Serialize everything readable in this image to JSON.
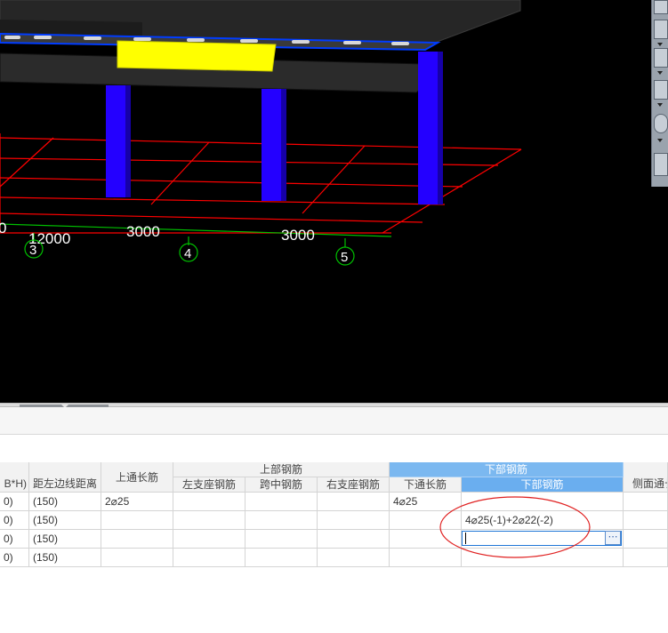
{
  "viewport": {
    "axis_labels": [
      "0",
      "12000",
      "3000",
      "3000"
    ],
    "axis_markers": [
      "3",
      "4",
      "5"
    ],
    "colors": {
      "background": "#000000",
      "grid_line": "#ff0000",
      "axis_line": "#00c000",
      "column": "#2400ff",
      "slab": "#2b2b2b",
      "selected_beam": "#ffff00",
      "beam_edge": "#003cff"
    }
  },
  "right_toolbar": {
    "icons": [
      "view-rotate-icon",
      "view-box-icon",
      "view-box-top-icon",
      "view-cube-icon",
      "orbit-icon",
      "layers-icon"
    ]
  },
  "table": {
    "columns": [
      {
        "key": "bh",
        "label": "B*H)"
      },
      {
        "key": "dist",
        "label": "距左边线距离"
      },
      {
        "key": "top_through",
        "label": "上通长筋"
      },
      {
        "key": "left_support",
        "label": "左支座钢筋"
      },
      {
        "key": "mid_span",
        "label": "跨中钢筋"
      },
      {
        "key": "right_support",
        "label": "右支座钢筋"
      },
      {
        "key": "bottom_through",
        "label": "下通长筋"
      },
      {
        "key": "bottom_bars",
        "label": "下部钢筋"
      },
      {
        "key": "side_through",
        "label": "侧面通长"
      }
    ],
    "group_headers": {
      "top_bars": "上部钢筋",
      "bottom_bars": "下部钢筋"
    },
    "rows": [
      {
        "bh": "0)",
        "dist": "(150)",
        "top_through": "2⌀25",
        "left_support": "",
        "mid_span": "",
        "right_support": "",
        "bottom_through": "4⌀25",
        "bottom_bars": "",
        "side_through": ""
      },
      {
        "bh": "0)",
        "dist": "(150)",
        "top_through": "",
        "left_support": "",
        "mid_span": "",
        "right_support": "",
        "bottom_through": "",
        "bottom_bars": "4⌀25(-1)+2⌀22(-2)",
        "side_through": ""
      },
      {
        "bh": "0)",
        "dist": "(150)",
        "top_through": "",
        "left_support": "",
        "mid_span": "",
        "right_support": "",
        "bottom_through": "",
        "bottom_bars": "",
        "side_through": ""
      },
      {
        "bh": "0)",
        "dist": "(150)",
        "top_through": "",
        "left_support": "",
        "mid_span": "",
        "right_support": "",
        "bottom_through": "",
        "bottom_bars": "",
        "side_through": ""
      }
    ],
    "edit_cell": {
      "value": "",
      "button_label": "⋯"
    },
    "accent_color": "#7bb8f0",
    "annotation_color": "#e02020"
  }
}
